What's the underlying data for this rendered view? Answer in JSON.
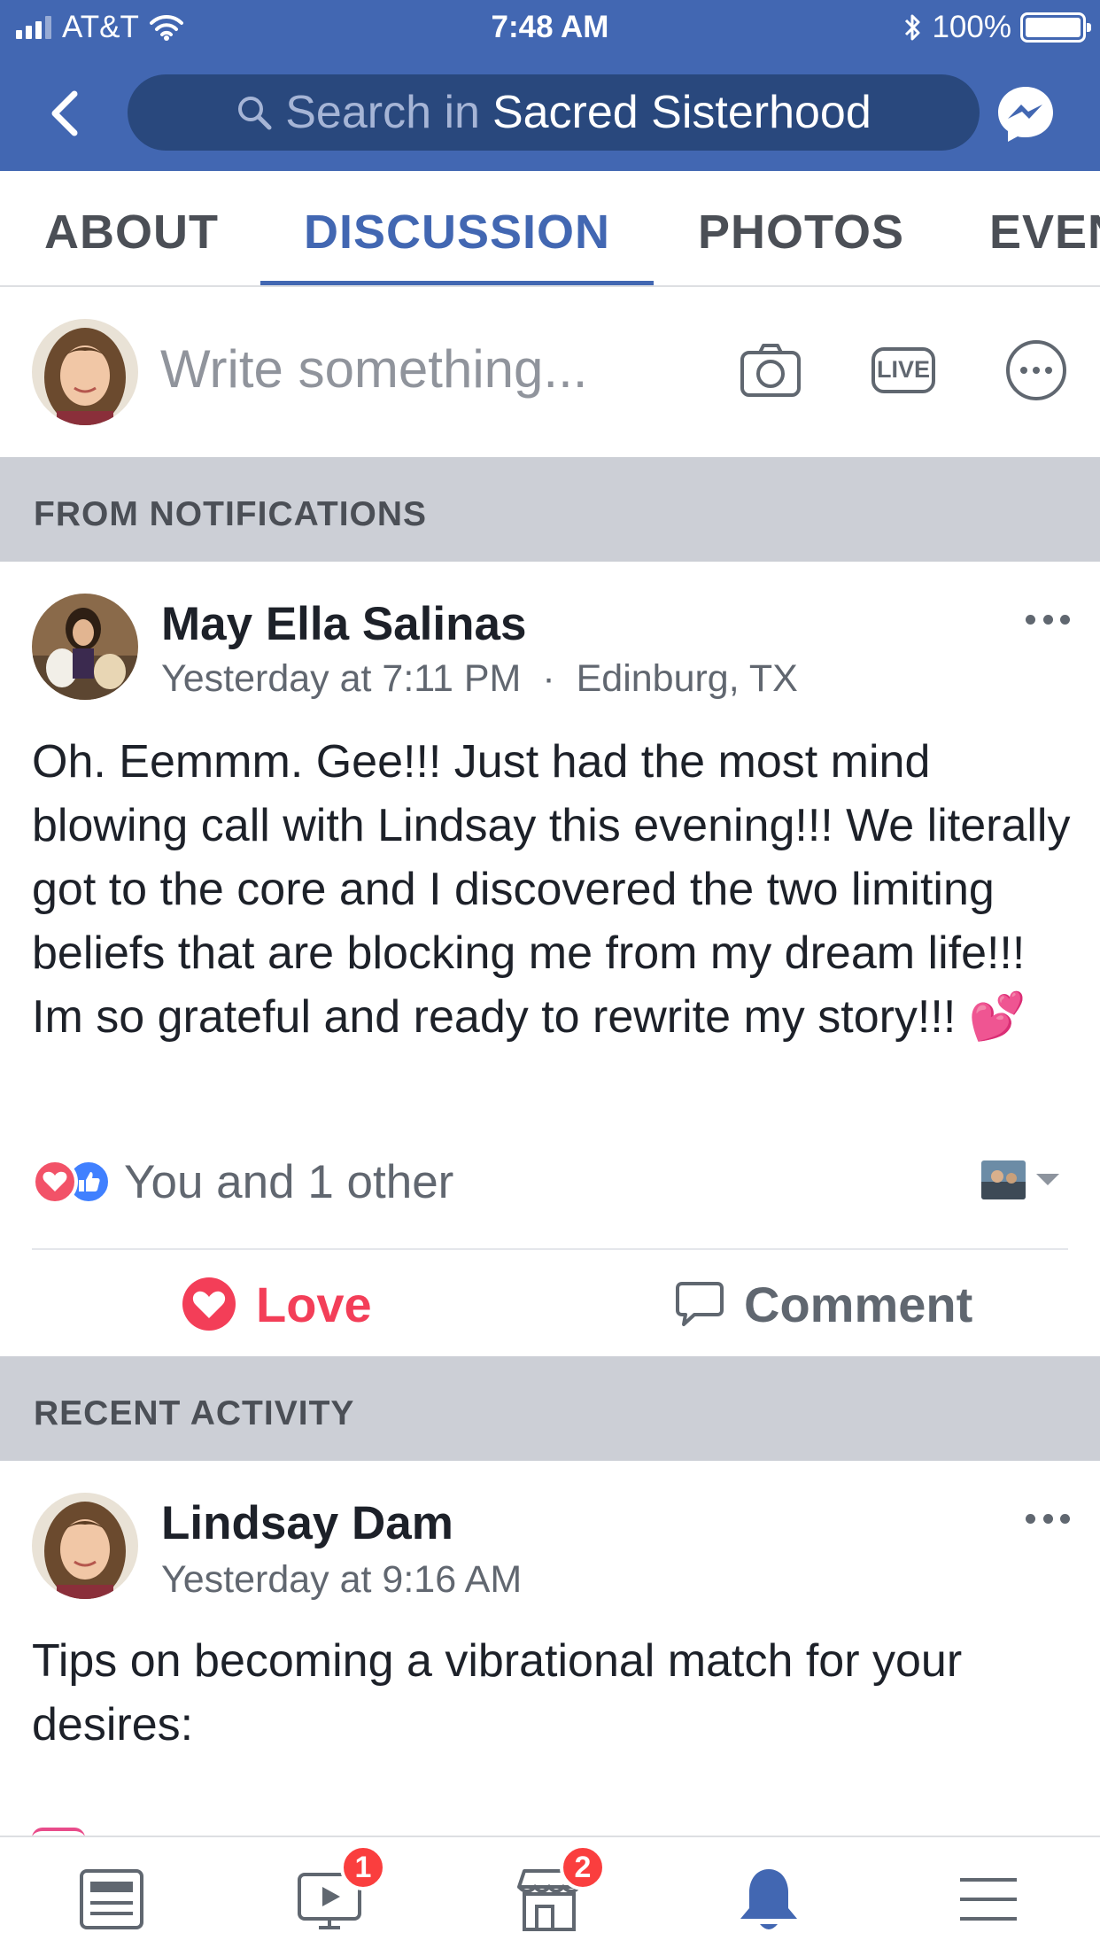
{
  "status_bar": {
    "carrier": "AT&T",
    "time": "7:48 AM",
    "battery": "100%"
  },
  "search": {
    "placeholder_prefix": "Search in",
    "group_name": "Sacred Sisterhood"
  },
  "tabs": [
    {
      "label": "ABOUT",
      "active": false
    },
    {
      "label": "DISCUSSION",
      "active": true
    },
    {
      "label": "PHOTOS",
      "active": false
    },
    {
      "label": "EVEN",
      "active": false
    }
  ],
  "composer": {
    "placeholder": "Write something...",
    "live_label": "LIVE"
  },
  "sections": {
    "notifications": "FROM NOTIFICATIONS",
    "recent": "RECENT ACTIVITY"
  },
  "posts": [
    {
      "author": "May Ella Salinas",
      "timestamp": "Yesterday at 7:11 PM",
      "separator": "·",
      "location": "Edinburg, TX",
      "text": "Oh. Eemmm. Gee!!! Just had the most mind blowing call with Lindsay this evening!!! We literally got to the core and I discovered the two limiting beliefs that are blocking me from my dream life!!! Im so grateful and ready to rewrite my story!!!",
      "emoji": "💕",
      "reactions_text": "You and 1 other",
      "love_label": "Love",
      "comment_label": "Comment"
    },
    {
      "author": "Lindsay Dam",
      "timestamp": "Yesterday at 9:16 AM",
      "text": "Tips on becoming a vibrational match for your desires:"
    }
  ],
  "bottom_nav": [
    {
      "icon": "news-feed-icon",
      "badge": null,
      "active": false
    },
    {
      "icon": "watch-icon",
      "badge": "1",
      "active": false
    },
    {
      "icon": "marketplace-icon",
      "badge": "2",
      "active": false
    },
    {
      "icon": "notifications-bell-icon",
      "badge": null,
      "active": true
    },
    {
      "icon": "menu-icon",
      "badge": null,
      "active": false
    }
  ],
  "colors": {
    "brand_blue": "#4267b2",
    "search_bg": "#29487d",
    "love_red": "#f33e58",
    "badge_red": "#fa3e3e",
    "section_gray": "#cccfd6"
  }
}
